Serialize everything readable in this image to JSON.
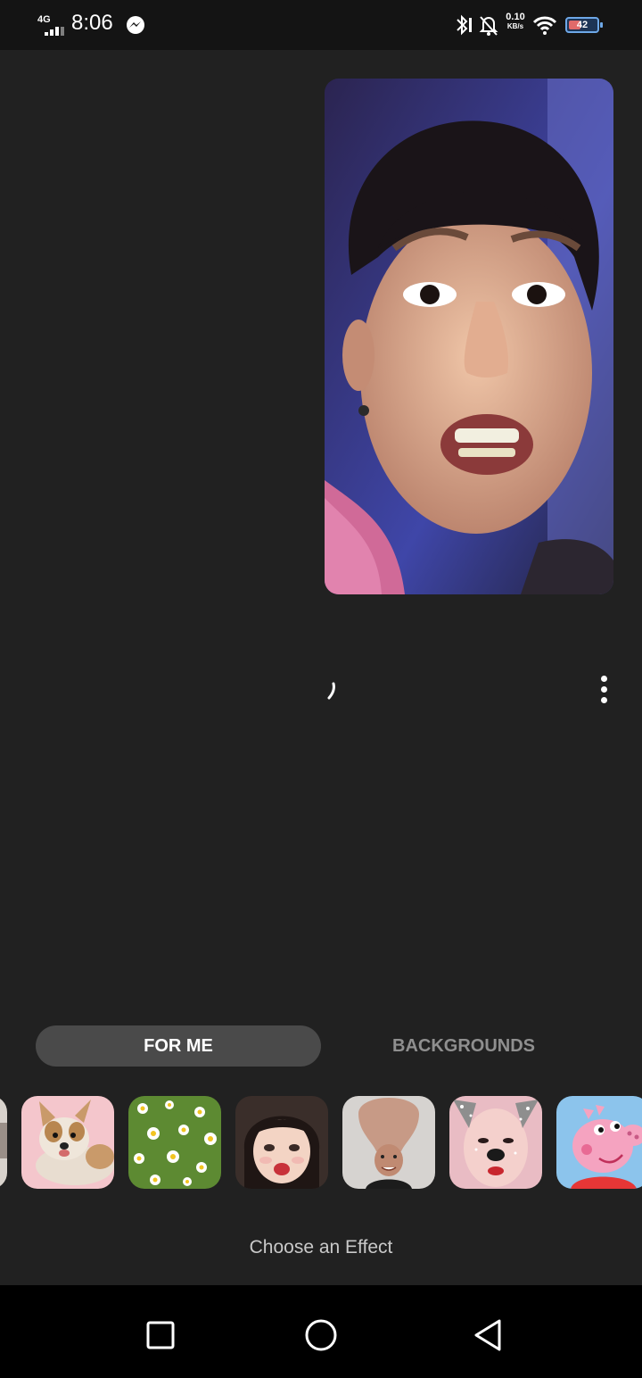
{
  "status_bar": {
    "network_type": "4G",
    "time": "8:06",
    "net_speed_value": "0.10",
    "net_speed_unit": "KB/s",
    "battery_level": "42",
    "battery_fraction": 0.42,
    "icons": [
      "signal-icon",
      "messenger-icon",
      "bluetooth-icon",
      "notifications-muted-icon",
      "wifi-icon",
      "battery-icon"
    ]
  },
  "call": {
    "self_view": "camera-preview",
    "loading_indicator": "spinner-icon",
    "menu_icon": "more-vertical-icon"
  },
  "effects_panel": {
    "tabs": [
      {
        "label": "FOR ME",
        "selected": true
      },
      {
        "label": "BACKGROUNDS",
        "selected": false
      }
    ],
    "effects": [
      "partial-effect",
      "dog-effect",
      "flower-field-effect",
      "doll-face-effect",
      "big-head-effect",
      "sparkle-dog-effect",
      "peppa-pig-effect"
    ],
    "choose_label": "Choose an Effect"
  },
  "nav_bar": {
    "buttons": [
      "recents-button",
      "home-button",
      "back-button"
    ]
  },
  "colors": {
    "background": "#212121",
    "status_bar": "#141414",
    "selected_tab": "#4a4a4a",
    "unselected_tab_text": "#8f8f8f",
    "nav_bar": "#000000"
  }
}
